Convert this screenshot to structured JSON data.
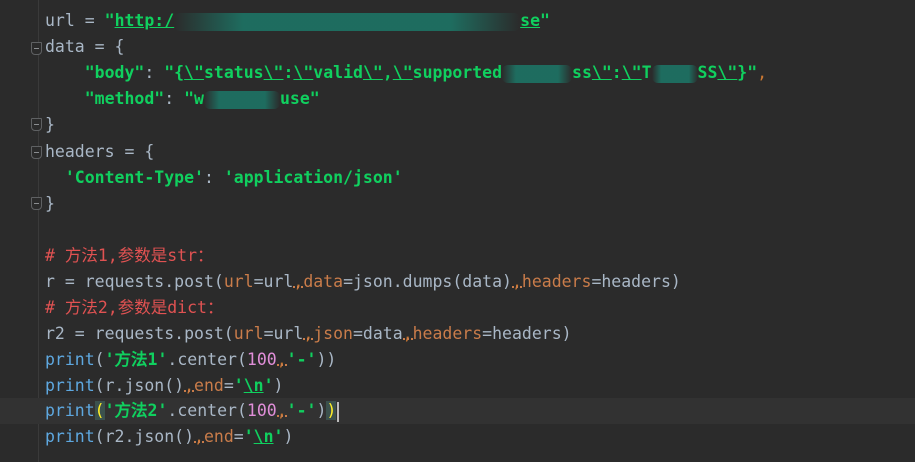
{
  "code": {
    "l1": {
      "var": "url",
      "eq": " = ",
      "q1": "\"",
      "url_start": "http:/",
      "url_end": "se",
      "q2": "\""
    },
    "l2": {
      "text": "data = {"
    },
    "l3": {
      "indent": "    ",
      "key": "\"body\"",
      "colon": ": ",
      "open": "\"{",
      "e1": "\\\"",
      "w1": "status",
      "e2": "\\\"",
      "c1": ":",
      "e3": "\\\"",
      "w2": "valid",
      "e4": "\\\"",
      "c2": ",",
      "e5": "\\\"",
      "w3": "supported",
      "w4": "ss",
      "e6": "\\\"",
      "c3": ":",
      "e7": "\\\"",
      "w5": "T",
      "w6": "SS",
      "e8": "\\\"",
      "close": "}\"",
      "comma": ","
    },
    "l4": {
      "indent": "    ",
      "key": "\"method\"",
      "colon": ": ",
      "v1": "\"w",
      "v2": "use\""
    },
    "l5": {
      "text": "}"
    },
    "l6": {
      "text": "headers = {"
    },
    "l7": {
      "indent": "  ",
      "key": "'Content-Type'",
      "colon": ": ",
      "val": "'application/json'"
    },
    "l8": {
      "text": "}"
    },
    "l9": {
      "text": "# 方法1,参数是str："
    },
    "l10": {
      "a": "r = requests.post(",
      "p1": "url",
      "b": "=url",
      "c": ",",
      "p2": "data",
      "d": "=json.dumps(data)",
      "e": ",",
      "p3": "headers",
      "f": "=headers)"
    },
    "l11": {
      "text": "# 方法2,参数是dict："
    },
    "l12": {
      "a": "r2 = requests.post(",
      "p1": "url",
      "b": "=url",
      "c": ",",
      "p2": "json",
      "d": "=data",
      "e": ",",
      "p3": "headers",
      "f": "=headers)"
    },
    "l13": {
      "fn": "print",
      "a": "(",
      "s": "'方法1'",
      "b": ".center(",
      "n": "100",
      "c": ",",
      "s2": "'-'",
      "d": "))"
    },
    "l14": {
      "fn": "print",
      "a": "(r.json()",
      "c": ",",
      "p": "end",
      "eq": "=",
      "q1": "'",
      "esc": "\\n",
      "q2": "'",
      "d": ")"
    },
    "l15": {
      "fn": "print",
      "a": "(",
      "s": "'方法2'",
      "b": ".center(",
      "n": "100",
      "c": ",",
      "s2": "'-'",
      "d": ")",
      "e": ")"
    },
    "l16": {
      "fn": "print",
      "a": "(r2.json()",
      "c": ",",
      "p": "end",
      "eq": "=",
      "q1": "'",
      "esc": "\\n",
      "q2": "'",
      "d": ")"
    }
  },
  "colors": {
    "background": "#2b2b2b",
    "current_line": "#323232",
    "keyword": "#cc7832",
    "string": "#10d05f",
    "comment": "#e05252",
    "parameter": "#c97c4a",
    "number": "#e08ed8",
    "function": "#5ea8e0"
  }
}
